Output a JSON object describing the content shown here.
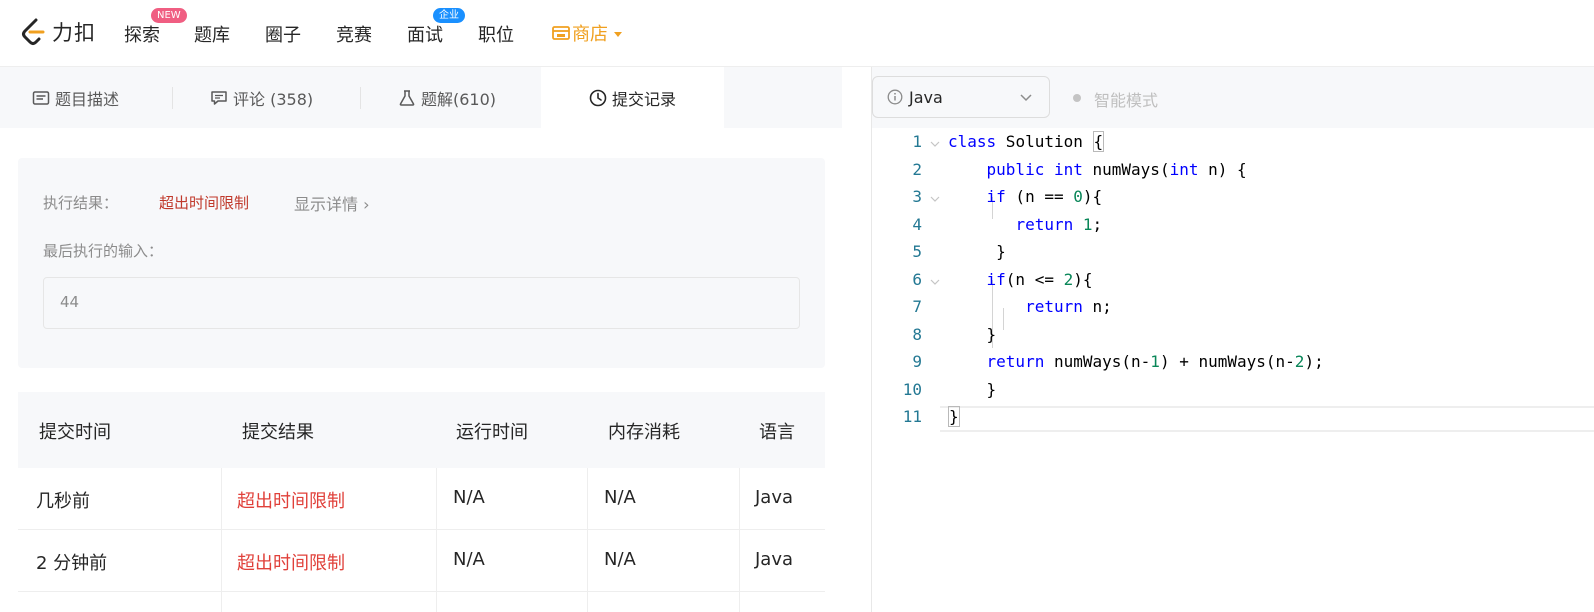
{
  "nav": {
    "logo_text": "力扣",
    "items": [
      {
        "label": "探索",
        "badge": "NEW"
      },
      {
        "label": "题库"
      },
      {
        "label": "圈子"
      },
      {
        "label": "竞赛"
      },
      {
        "label": "面试",
        "badge": "企业"
      },
      {
        "label": "职位"
      }
    ],
    "store_label": "商店",
    "store_color": "#f0a020"
  },
  "tabs": [
    {
      "label": "题目描述",
      "icon": "description-icon"
    },
    {
      "label": "评论 (358)",
      "icon": "comment-icon"
    },
    {
      "label": "题解(610)",
      "icon": "flask-icon"
    },
    {
      "label": "提交记录",
      "icon": "clock-icon",
      "active": true
    }
  ],
  "result": {
    "label": "执行结果：",
    "status": "超出时间限制",
    "detail_link": "显示详情 ›",
    "last_input_label": "最后执行的输入：",
    "last_input_value": "44"
  },
  "submissions": {
    "headers": [
      "提交时间",
      "提交结果",
      "运行时间",
      "内存消耗",
      "语言"
    ],
    "rows": [
      {
        "time": "几秒前",
        "result": "超出时间限制",
        "runtime": "N/A",
        "memory": "N/A",
        "lang": "Java"
      },
      {
        "time": "2 分钟前",
        "result": "超出时间限制",
        "runtime": "N/A",
        "memory": "N/A",
        "lang": "Java"
      }
    ]
  },
  "editor": {
    "language": "Java",
    "smart_mode": "智能模式",
    "lines": [
      {
        "n": "1",
        "code": "class Solution {"
      },
      {
        "n": "2",
        "code": "    public int numWays(int n) {"
      },
      {
        "n": "3",
        "code": "    if (n == 0){"
      },
      {
        "n": "4",
        "code": "       return 1;"
      },
      {
        "n": "5",
        "code": "     }"
      },
      {
        "n": "6",
        "code": "    if(n <= 2){"
      },
      {
        "n": "7",
        "code": "        return n;"
      },
      {
        "n": "8",
        "code": "    }"
      },
      {
        "n": "9",
        "code": "    return numWays(n-1) + numWays(n-2);"
      },
      {
        "n": "10",
        "code": "    }"
      },
      {
        "n": "11",
        "code": "}"
      }
    ]
  },
  "colors": {
    "error": "#e0403a",
    "keyword": "#0000ff",
    "number": "#098658",
    "line_number": "#237893"
  }
}
